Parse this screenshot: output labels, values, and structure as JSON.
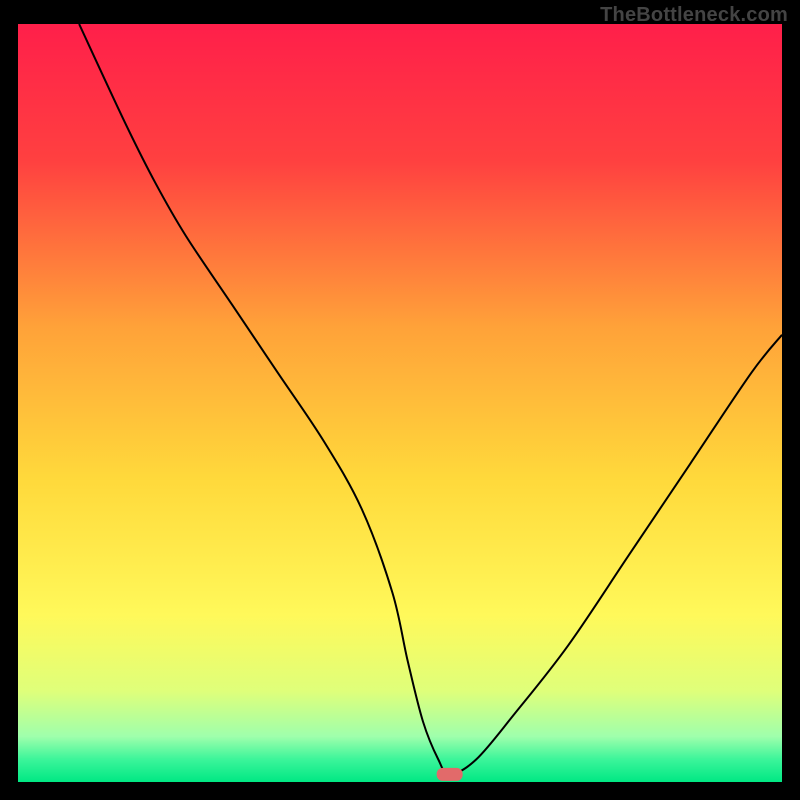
{
  "watermark": "TheBottleneck.com",
  "chart_data": {
    "type": "line",
    "title": "",
    "xlabel": "",
    "ylabel": "",
    "xlim": [
      0,
      100
    ],
    "ylim": [
      0,
      100
    ],
    "grid": false,
    "series": [
      {
        "name": "bottleneck-curve",
        "x": [
          8,
          14,
          18,
          22,
          28,
          34,
          40,
          45,
          49,
          51,
          53,
          55,
          56.5,
          60,
          65,
          72,
          80,
          88,
          96,
          100
        ],
        "values": [
          100,
          87,
          79,
          72,
          63,
          54,
          45,
          36,
          25,
          16,
          8,
          3,
          1,
          3,
          9,
          18,
          30,
          42,
          54,
          59
        ]
      }
    ],
    "gradient_stops": [
      {
        "offset": 0,
        "color": "#ff1f4a"
      },
      {
        "offset": 18,
        "color": "#ff4040"
      },
      {
        "offset": 40,
        "color": "#ffa239"
      },
      {
        "offset": 60,
        "color": "#ffd93b"
      },
      {
        "offset": 78,
        "color": "#fff95a"
      },
      {
        "offset": 88,
        "color": "#dfff7a"
      },
      {
        "offset": 94,
        "color": "#9fffac"
      },
      {
        "offset": 97,
        "color": "#3cf59a"
      },
      {
        "offset": 100,
        "color": "#00e884"
      }
    ],
    "optimal_marker": {
      "x": 56.5,
      "y": 1
    }
  }
}
